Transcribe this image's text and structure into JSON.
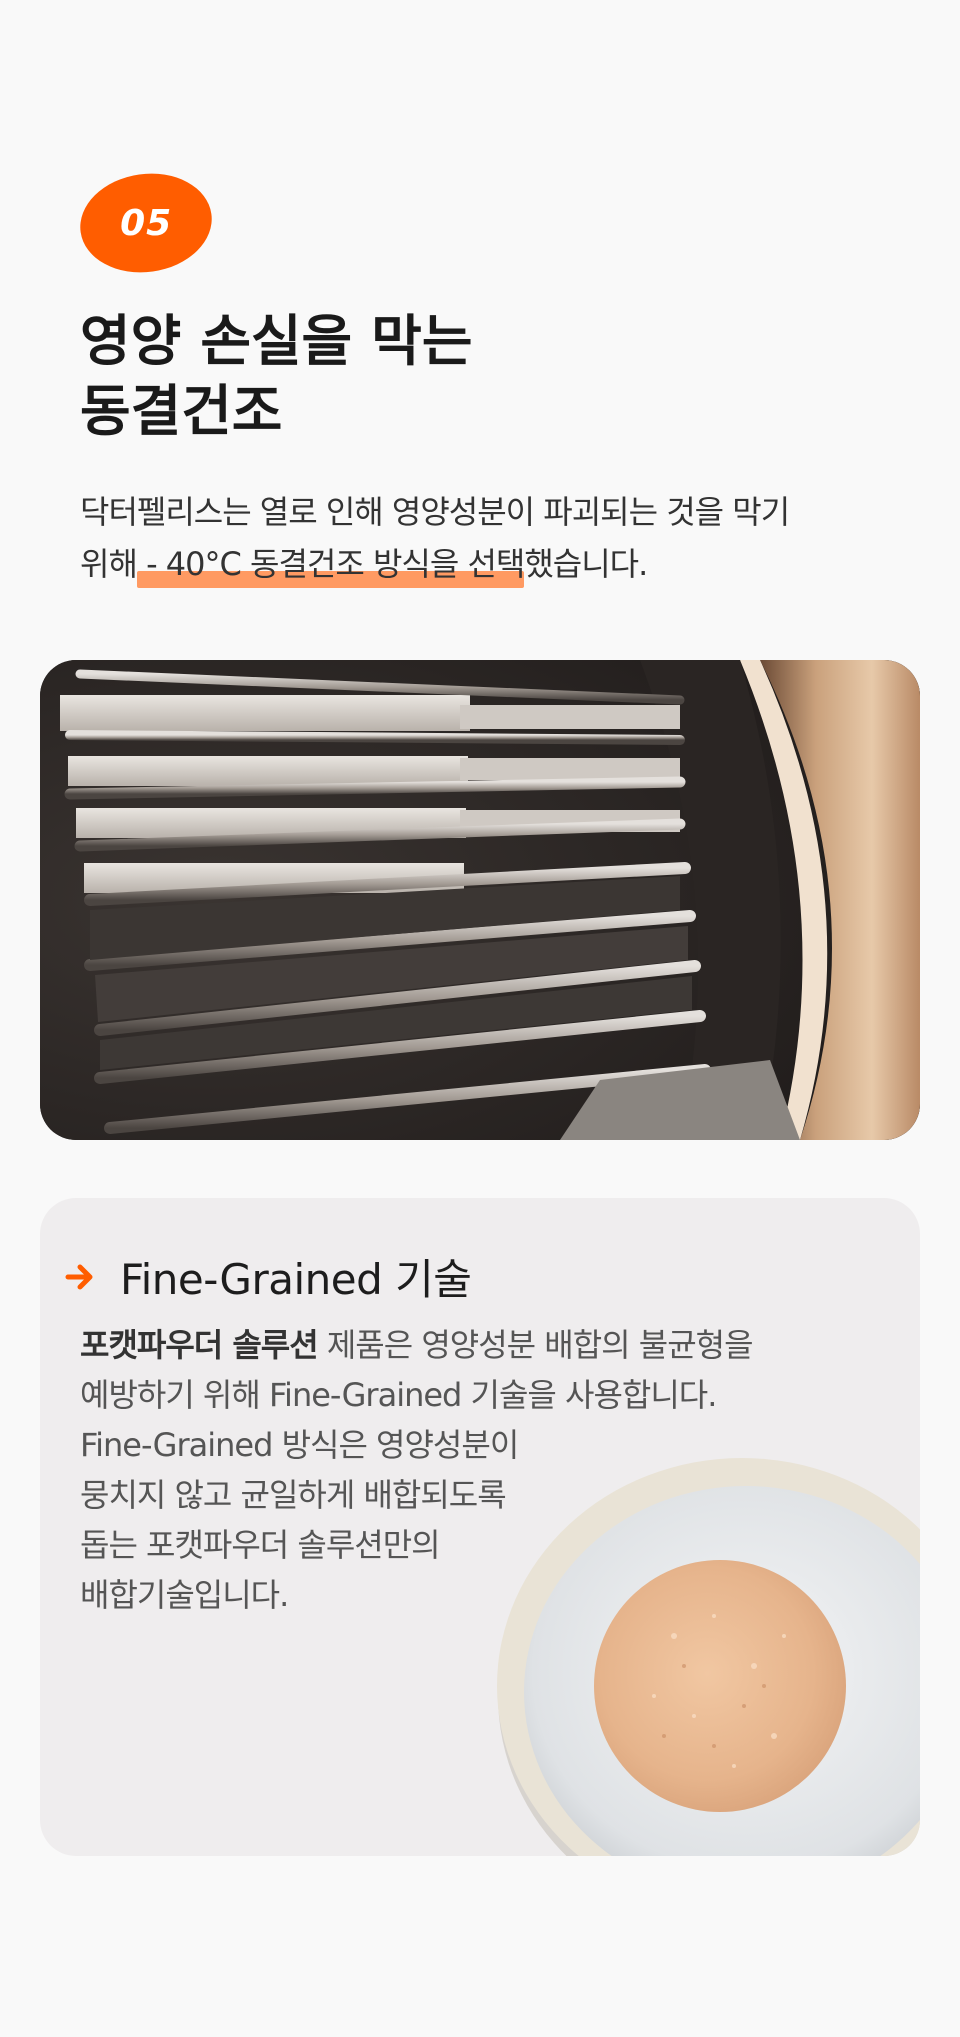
{
  "badge": {
    "number": "05"
  },
  "title": {
    "line1": "영양 손실을 막는",
    "line2": "동결건조"
  },
  "intro": {
    "line1": "닥터펠리스는 열로 인해 영양성분이 파괴되는 것을 막기",
    "line2_prefix": "위해",
    "line2_highlight": " - 40°C 동결건조 방식을 선택",
    "line2_suffix": "했습니다."
  },
  "card": {
    "heading": "Fine-Grained 기술",
    "line1_strong": "포캣파우더 솔루션",
    "line1_rest": " 제품은 영양성분 배합의 불균형을",
    "line2": "예방하기 위해 Fine-Grained 기술을 사용합니다.",
    "line3": "Fine-Grained 방식은 영양성분이",
    "line4": "뭉치지 않고 균일하게 배합되도록",
    "line5": "돕는 포캣파우더 솔루션만의",
    "line6": "배합기술입니다."
  },
  "colors": {
    "accent": "#ff5d00",
    "highlight": "#ff9a62",
    "card_bg": "#efedee"
  }
}
